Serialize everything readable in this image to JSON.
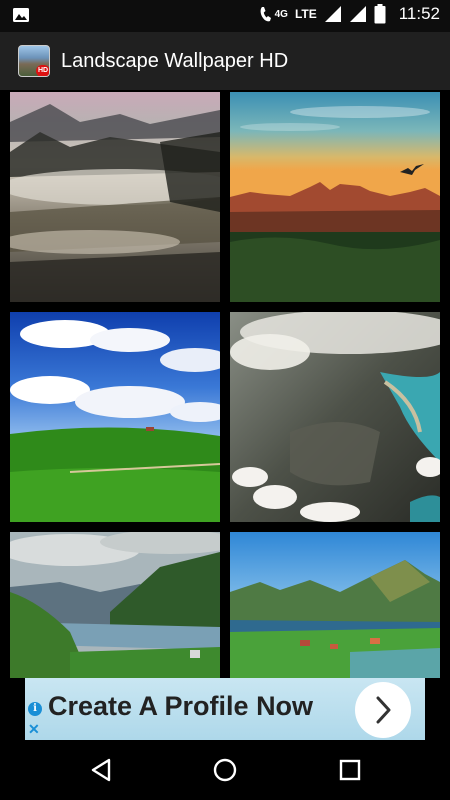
{
  "status_bar": {
    "network_label": "4G",
    "lte_label": "LTE",
    "time": "11:52",
    "icons": [
      "image-notification-icon",
      "wifi-calling-icon",
      "signal-icon",
      "signal-icon",
      "battery-icon"
    ]
  },
  "app_bar": {
    "title": "Landscape Wallpaper HD",
    "icon_badge": "HD",
    "icon": "app-logo-icon"
  },
  "wallpapers": [
    {
      "id": 1,
      "subject": "misty forest valley"
    },
    {
      "id": 2,
      "subject": "red rock canyon sunset with bird"
    },
    {
      "id": 3,
      "subject": "green hill blue sky clouds"
    },
    {
      "id": 4,
      "subject": "aerial coastline with clouds"
    },
    {
      "id": 5,
      "subject": "fjord with green hills"
    },
    {
      "id": 6,
      "subject": "alpine lake and village"
    }
  ],
  "ad": {
    "text": "Create A Profile Now",
    "info_glyph": "i",
    "close_glyph": "✕",
    "colors": {
      "background": "#bfe0ef",
      "accent": "#1a8fd6"
    }
  },
  "nav_bar": {
    "icons": [
      "back-icon",
      "home-icon",
      "recents-icon"
    ]
  }
}
